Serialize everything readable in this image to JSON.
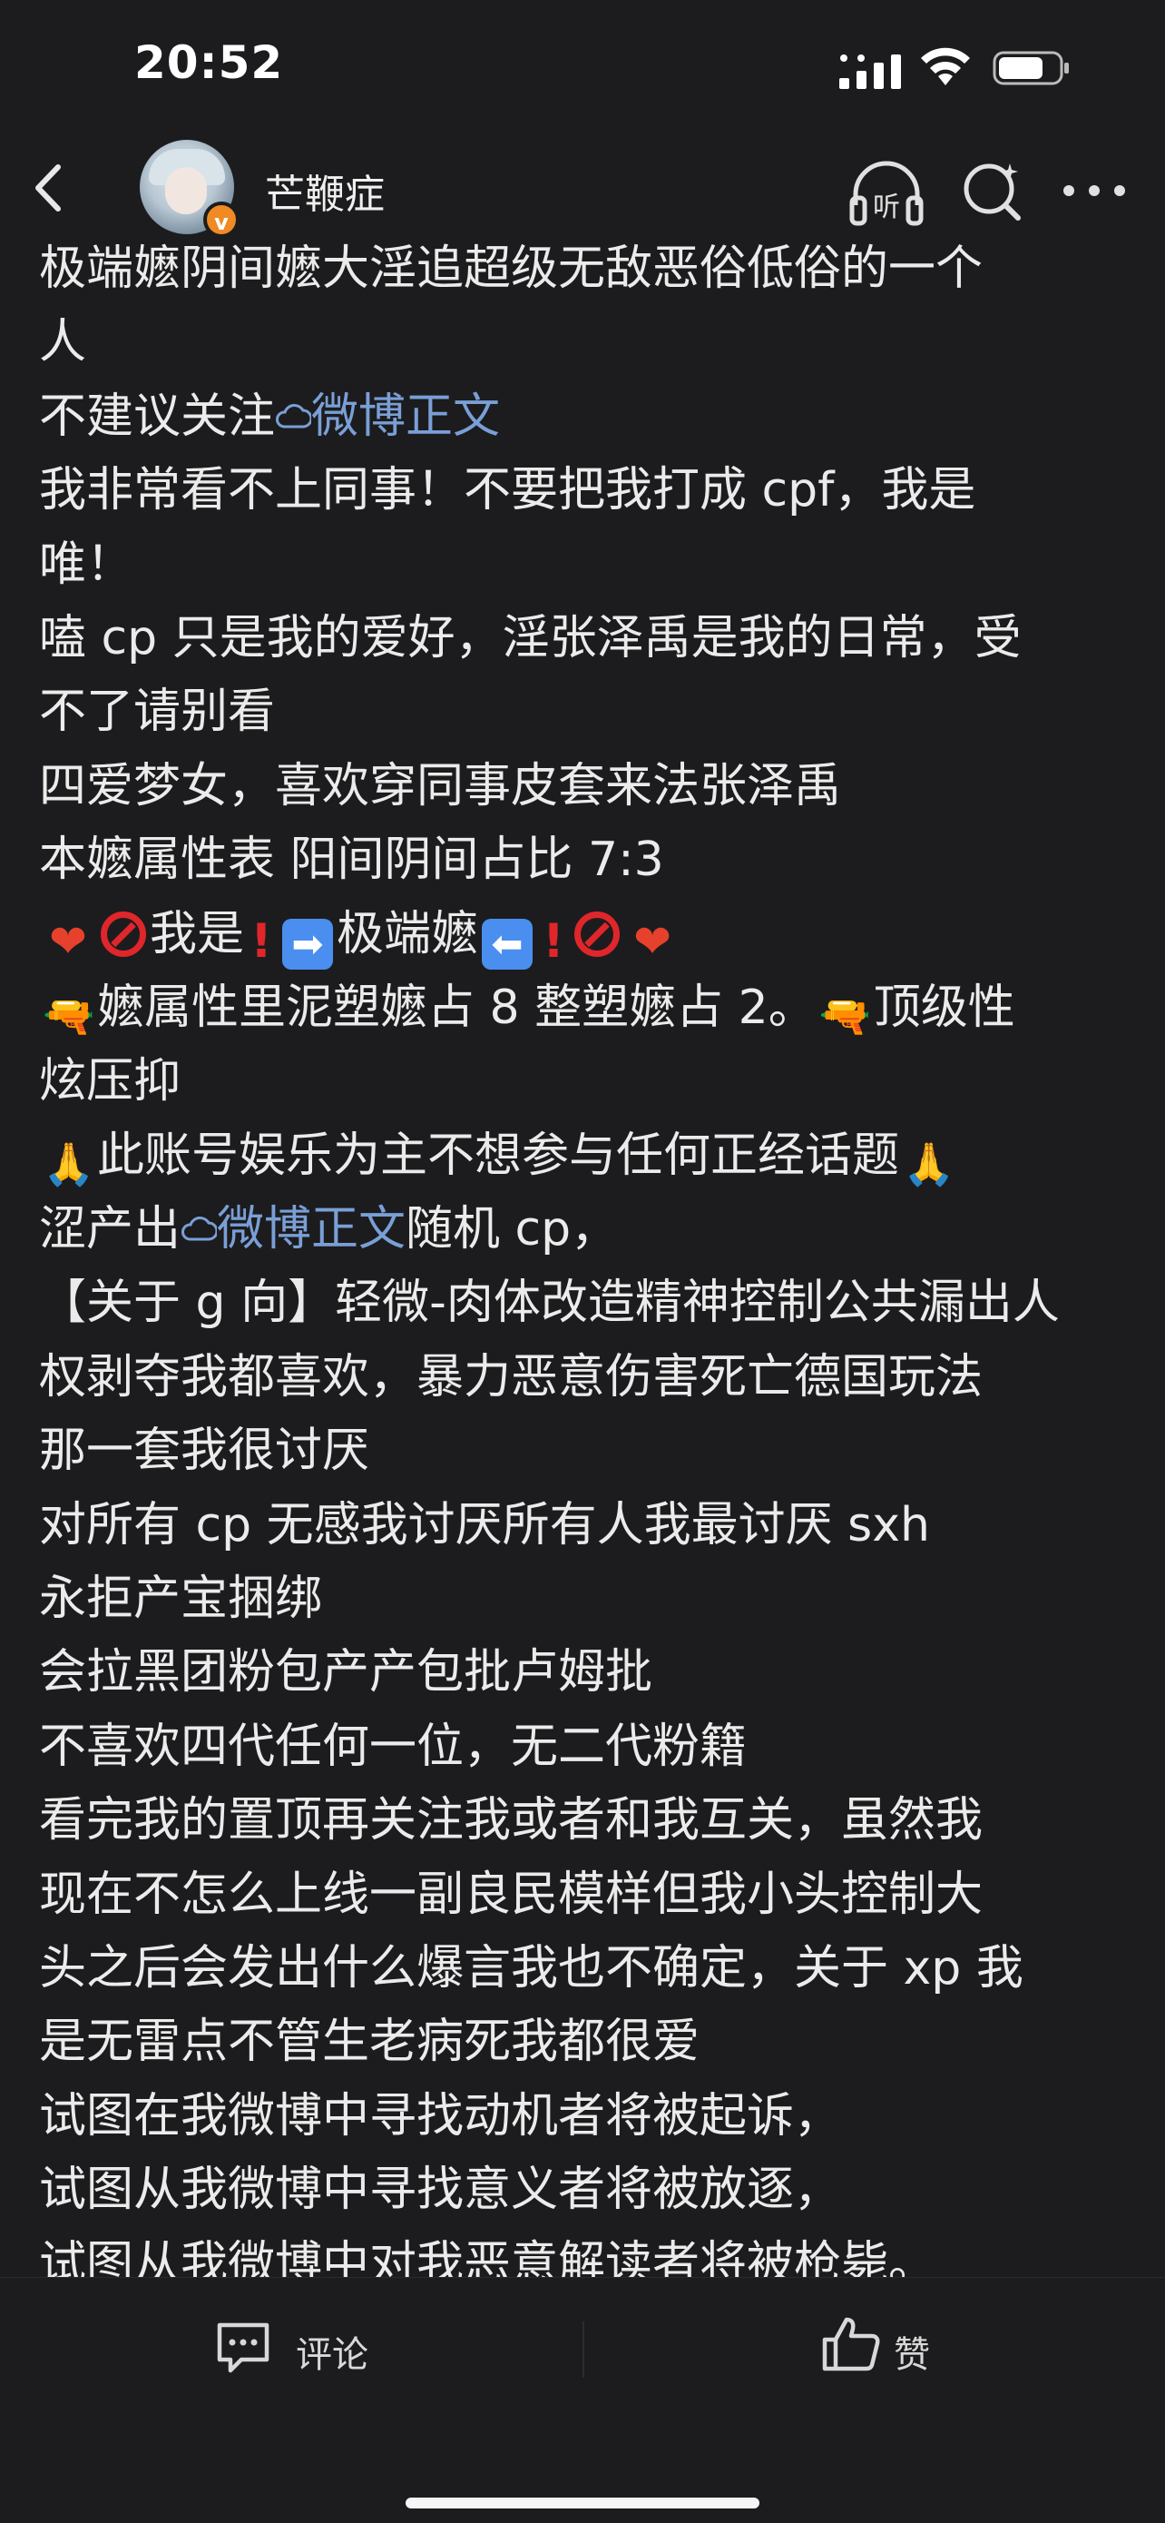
{
  "status_bar": {
    "time": "20:52"
  },
  "header": {
    "username": "芒鞭症",
    "verified_badge": "v"
  },
  "icons": {
    "back": "chevron-left-icon",
    "listen": "headphones-listen-icon",
    "search": "search-icon",
    "more": "more-dots-icon",
    "listen_label": "听"
  },
  "post": {
    "l01": "极端嬷阴间嬷大淫追超级无敌恶俗低俗的一个",
    "l02": "人",
    "l03_a": "不建议关注",
    "l03_link": "微博正文",
    "l04": "我非常看不上同事！不要把我打成 cpf，我是",
    "l05": "唯！",
    "l06": "嗑 cp 只是我的爱好，淫张泽禹是我的日常，受",
    "l07": "不了请别看",
    "l08": "四爱梦女，喜欢穿同事皮套来法张泽禹",
    "l09": "本嬷属性表 阳间阴间占比 7:3",
    "l10_text": "我是",
    "l10_mid": "极端嬷",
    "l11": "嬷属性里泥塑嬷占 8 整塑嬷占 2。",
    "l11_b": "顶级性",
    "l12": "炫压抑",
    "l13": "此账号娱乐为主不想参与任何正经话题",
    "l14_a": "涩产出",
    "l14_link": "微博正文",
    "l14_b": "随机 cp，",
    "l15": "【关于 g 向】轻微-肉体改造精神控制公共漏出人",
    "l16": "权剥夺我都喜欢，暴力恶意伤害死亡德国玩法",
    "l17": "那一套我很讨厌",
    "l18": "对所有 cp 无感我讨厌所有人我最讨厌 sxh",
    "l19": "永拒产宝捆绑",
    "l20": "会拉黑团粉包产产包批卢姆批",
    "l21": "不喜欢四代任何一位，无二代粉籍",
    "l22": "看完我的置顶再关注我或者和我互关，虽然我",
    "l23": "现在不怎么上线一副良民模样但我小头控制大",
    "l24": "头之后会发出什么爆言我也不确定，关于 xp 我",
    "l25": "是无雷点不管生老病死我都很爱",
    "l26": "试图在我微博中寻找动机者将被起诉，",
    "l27": "试图从我微博中寻找意义者将被放逐，",
    "l28": "试图从我微博中对我恶意解读者将被枪毙。"
  },
  "emoji": {
    "heart": "❤",
    "bang": "!",
    "arrow_right": "➡",
    "arrow_left": "⬅",
    "gun": "🔫",
    "pray": "🙏"
  },
  "bottom_bar": {
    "comment_label": "评论",
    "like_label": "赞"
  },
  "colors": {
    "background": "#1c1c1e",
    "text": "#ebebeb",
    "link": "#7a9fd6",
    "badge": "#f08a24"
  }
}
